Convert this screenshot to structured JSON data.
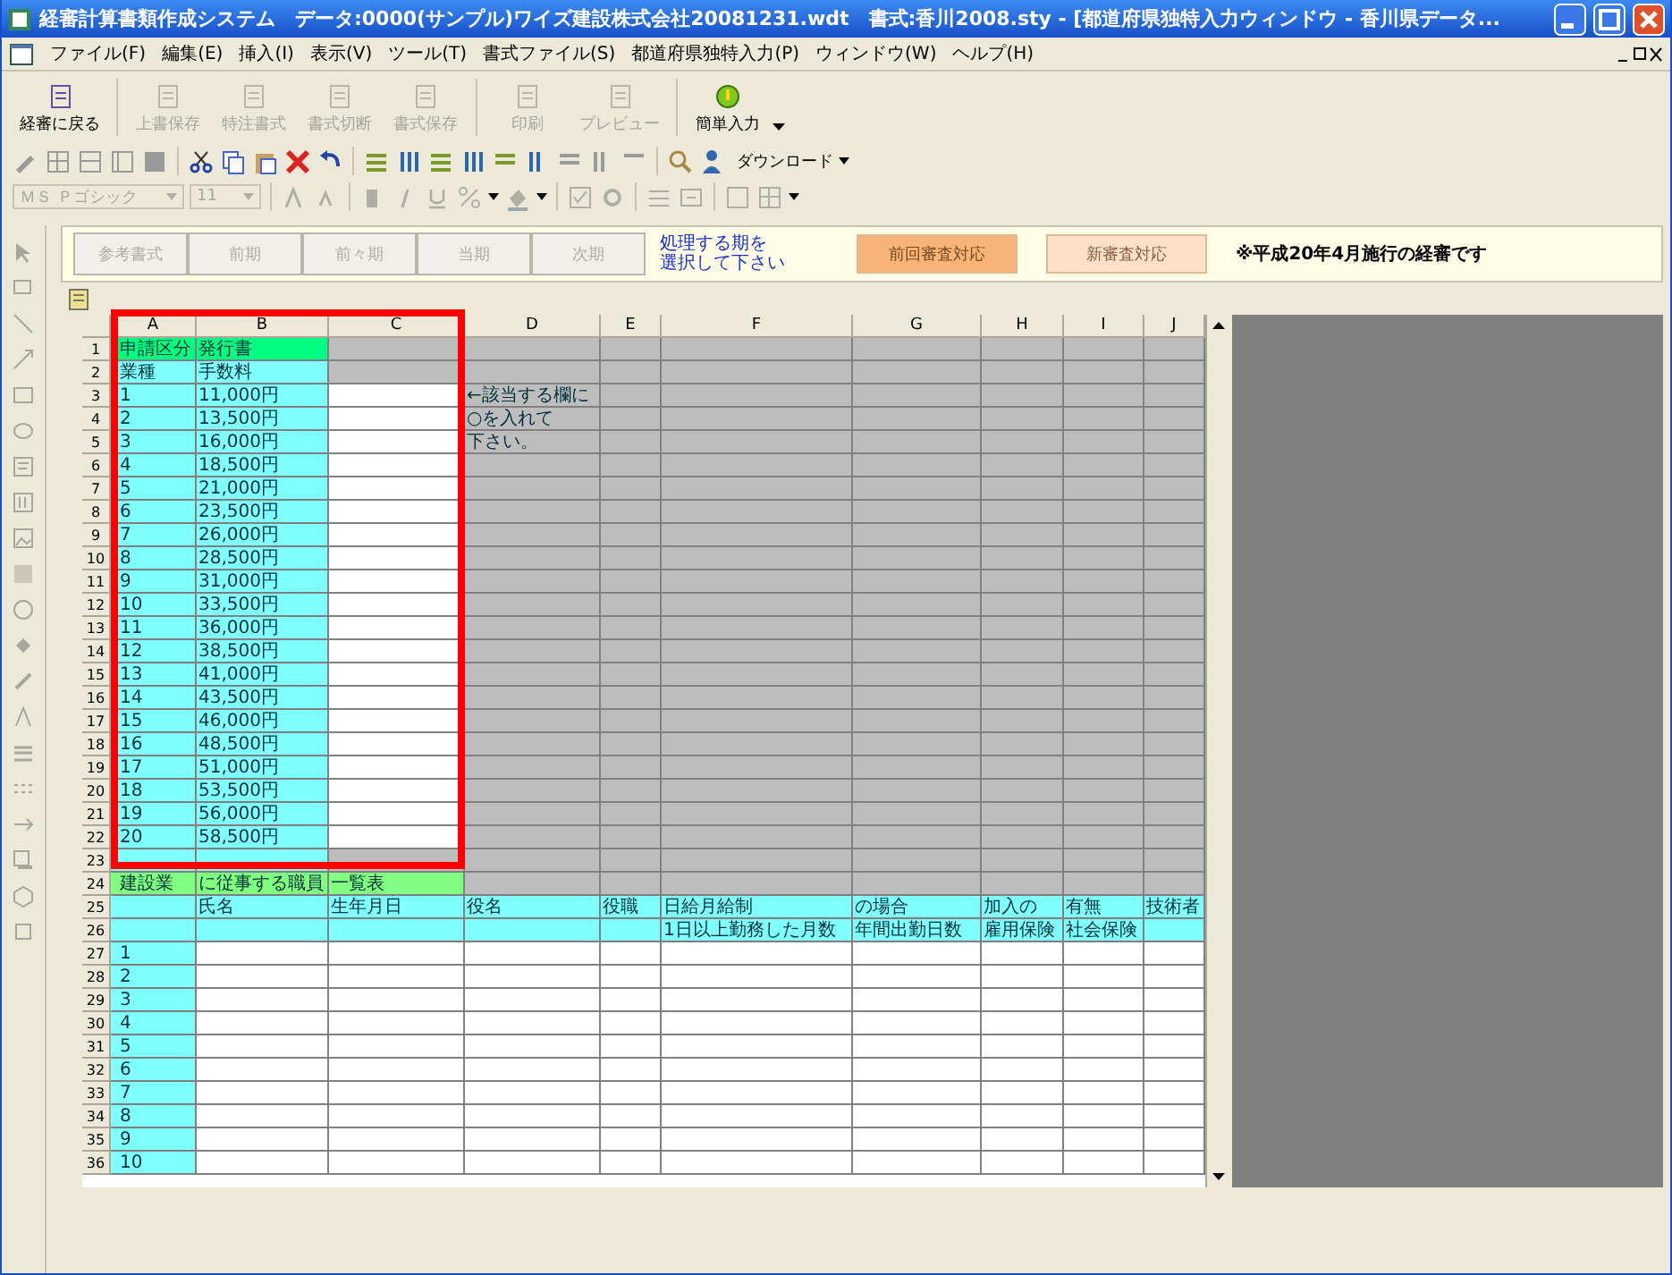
{
  "window": {
    "title": "経審計算書類作成システム　データ:0000(サンプル)ワイズ建設株式会社20081231.wdt　書式:香川2008.sty - [都道府県独特入力ウィンドウ - 香川県データ..."
  },
  "menu": [
    "ファイル(F)",
    "編集(E)",
    "挿入(I)",
    "表示(V)",
    "ツール(T)",
    "書式ファイル(S)",
    "都道府県独特入力(P)",
    "ウィンドウ(W)",
    "ヘルプ(H)"
  ],
  "toolbar": [
    {
      "label": "経審に戻る",
      "disabled": false
    },
    {
      "label": "上書保存",
      "disabled": true
    },
    {
      "label": "特注書式",
      "disabled": true
    },
    {
      "label": "書式切断",
      "disabled": true
    },
    {
      "label": "書式保存",
      "disabled": true
    },
    {
      "label": "印刷",
      "disabled": true
    },
    {
      "label": "プレビュー",
      "disabled": true
    },
    {
      "label": "簡単入力",
      "disabled": false
    }
  ],
  "download_button": "ダウンロード",
  "font_field": {
    "value": "ＭＳ Ｐゴシック",
    "disabled": true
  },
  "size_field": {
    "value": "11",
    "disabled": true
  },
  "period_buttons": [
    {
      "label": "参考書式",
      "disabled": true
    },
    {
      "label": "前期",
      "disabled": true
    },
    {
      "label": "前々期",
      "disabled": true
    },
    {
      "label": "当期",
      "disabled": true
    },
    {
      "label": "次期",
      "disabled": true
    }
  ],
  "period_hint": [
    "処理する期を",
    "選択して下さい"
  ],
  "review_buttons": [
    {
      "label": "前回審査対応",
      "selected": true
    },
    {
      "label": "新審査対応",
      "selected": false
    }
  ],
  "notice": "※平成20年4月施行の経審です",
  "sheet": {
    "columns": [
      "A",
      "B",
      "C",
      "D",
      "E",
      "F",
      "G",
      "H",
      "I",
      "J"
    ],
    "rows": [
      {
        "number": "1",
        "cells": [
          {
            "kind": "heading",
            "text": "申請区分"
          },
          {
            "kind": "heading",
            "text": "発行書"
          },
          {
            "kind": "locked"
          },
          {
            "kind": "locked"
          },
          {
            "kind": "locked"
          },
          {
            "kind": "locked"
          },
          {
            "kind": "locked"
          },
          {
            "kind": "locked"
          },
          {
            "kind": "locked"
          },
          {
            "kind": "locked"
          }
        ]
      },
      {
        "number": "2",
        "cells": [
          {
            "kind": "label",
            "text": "業種"
          },
          {
            "kind": "label",
            "text": "手数料"
          },
          {
            "kind": "locked"
          },
          {
            "kind": "locked"
          },
          {
            "kind": "locked"
          },
          {
            "kind": "locked"
          },
          {
            "kind": "locked"
          },
          {
            "kind": "locked"
          },
          {
            "kind": "locked"
          },
          {
            "kind": "locked"
          }
        ]
      },
      {
        "number": "3",
        "cells": [
          {
            "kind": "label",
            "text": "1"
          },
          {
            "kind": "label",
            "text": "11,000円"
          },
          {
            "kind": "entry"
          },
          {
            "kind": "locked",
            "text": "←該当する欄に"
          },
          {
            "kind": "locked"
          },
          {
            "kind": "locked"
          },
          {
            "kind": "locked"
          },
          {
            "kind": "locked"
          },
          {
            "kind": "locked"
          },
          {
            "kind": "locked"
          }
        ]
      },
      {
        "number": "4",
        "cells": [
          {
            "kind": "label",
            "text": "2"
          },
          {
            "kind": "label",
            "text": "13,500円"
          },
          {
            "kind": "entry"
          },
          {
            "kind": "locked",
            "text": "○を入れて"
          },
          {
            "kind": "locked"
          },
          {
            "kind": "locked"
          },
          {
            "kind": "locked"
          },
          {
            "kind": "locked"
          },
          {
            "kind": "locked"
          },
          {
            "kind": "locked"
          }
        ]
      },
      {
        "number": "5",
        "cells": [
          {
            "kind": "label",
            "text": "3"
          },
          {
            "kind": "label",
            "text": "16,000円"
          },
          {
            "kind": "entry"
          },
          {
            "kind": "locked",
            "text": "下さい。"
          },
          {
            "kind": "locked"
          },
          {
            "kind": "locked"
          },
          {
            "kind": "locked"
          },
          {
            "kind": "locked"
          },
          {
            "kind": "locked"
          },
          {
            "kind": "locked"
          }
        ]
      },
      {
        "number": "6",
        "cells": [
          {
            "kind": "label",
            "text": "4"
          },
          {
            "kind": "label",
            "text": "18,500円"
          },
          {
            "kind": "entry"
          },
          {
            "kind": "locked"
          },
          {
            "kind": "locked"
          },
          {
            "kind": "locked"
          },
          {
            "kind": "locked"
          },
          {
            "kind": "locked"
          },
          {
            "kind": "locked"
          },
          {
            "kind": "locked"
          }
        ]
      },
      {
        "number": "7",
        "cells": [
          {
            "kind": "label",
            "text": "5"
          },
          {
            "kind": "label",
            "text": "21,000円"
          },
          {
            "kind": "entry"
          },
          {
            "kind": "locked"
          },
          {
            "kind": "locked"
          },
          {
            "kind": "locked"
          },
          {
            "kind": "locked"
          },
          {
            "kind": "locked"
          },
          {
            "kind": "locked"
          },
          {
            "kind": "locked"
          }
        ]
      },
      {
        "number": "8",
        "cells": [
          {
            "kind": "label",
            "text": "6"
          },
          {
            "kind": "label",
            "text": "23,500円"
          },
          {
            "kind": "entry"
          },
          {
            "kind": "locked"
          },
          {
            "kind": "locked"
          },
          {
            "kind": "locked"
          },
          {
            "kind": "locked"
          },
          {
            "kind": "locked"
          },
          {
            "kind": "locked"
          },
          {
            "kind": "locked"
          }
        ]
      },
      {
        "number": "9",
        "cells": [
          {
            "kind": "label",
            "text": "7"
          },
          {
            "kind": "label",
            "text": "26,000円"
          },
          {
            "kind": "entry"
          },
          {
            "kind": "locked"
          },
          {
            "kind": "locked"
          },
          {
            "kind": "locked"
          },
          {
            "kind": "locked"
          },
          {
            "kind": "locked"
          },
          {
            "kind": "locked"
          },
          {
            "kind": "locked"
          }
        ]
      },
      {
        "number": "10",
        "cells": [
          {
            "kind": "label",
            "text": "8"
          },
          {
            "kind": "label",
            "text": "28,500円"
          },
          {
            "kind": "entry"
          },
          {
            "kind": "locked"
          },
          {
            "kind": "locked"
          },
          {
            "kind": "locked"
          },
          {
            "kind": "locked"
          },
          {
            "kind": "locked"
          },
          {
            "kind": "locked"
          },
          {
            "kind": "locked"
          }
        ]
      },
      {
        "number": "11",
        "cells": [
          {
            "kind": "label",
            "text": "9"
          },
          {
            "kind": "label",
            "text": "31,000円"
          },
          {
            "kind": "entry"
          },
          {
            "kind": "locked"
          },
          {
            "kind": "locked"
          },
          {
            "kind": "locked"
          },
          {
            "kind": "locked"
          },
          {
            "kind": "locked"
          },
          {
            "kind": "locked"
          },
          {
            "kind": "locked"
          }
        ]
      },
      {
        "number": "12",
        "cells": [
          {
            "kind": "label",
            "text": "10"
          },
          {
            "kind": "label",
            "text": "33,500円"
          },
          {
            "kind": "entry"
          },
          {
            "kind": "locked"
          },
          {
            "kind": "locked"
          },
          {
            "kind": "locked"
          },
          {
            "kind": "locked"
          },
          {
            "kind": "locked"
          },
          {
            "kind": "locked"
          },
          {
            "kind": "locked"
          }
        ]
      },
      {
        "number": "13",
        "cells": [
          {
            "kind": "label",
            "text": "11"
          },
          {
            "kind": "label",
            "text": "36,000円"
          },
          {
            "kind": "entry"
          },
          {
            "kind": "locked"
          },
          {
            "kind": "locked"
          },
          {
            "kind": "locked"
          },
          {
            "kind": "locked"
          },
          {
            "kind": "locked"
          },
          {
            "kind": "locked"
          },
          {
            "kind": "locked"
          }
        ]
      },
      {
        "number": "14",
        "cells": [
          {
            "kind": "label",
            "text": "12"
          },
          {
            "kind": "label",
            "text": "38,500円"
          },
          {
            "kind": "entry"
          },
          {
            "kind": "locked"
          },
          {
            "kind": "locked"
          },
          {
            "kind": "locked"
          },
          {
            "kind": "locked"
          },
          {
            "kind": "locked"
          },
          {
            "kind": "locked"
          },
          {
            "kind": "locked"
          }
        ]
      },
      {
        "number": "15",
        "cells": [
          {
            "kind": "label",
            "text": "13"
          },
          {
            "kind": "label",
            "text": "41,000円"
          },
          {
            "kind": "entry"
          },
          {
            "kind": "locked"
          },
          {
            "kind": "locked"
          },
          {
            "kind": "locked"
          },
          {
            "kind": "locked"
          },
          {
            "kind": "locked"
          },
          {
            "kind": "locked"
          },
          {
            "kind": "locked"
          }
        ]
      },
      {
        "number": "16",
        "cells": [
          {
            "kind": "label",
            "text": "14"
          },
          {
            "kind": "label",
            "text": "43,500円"
          },
          {
            "kind": "entry"
          },
          {
            "kind": "locked"
          },
          {
            "kind": "locked"
          },
          {
            "kind": "locked"
          },
          {
            "kind": "locked"
          },
          {
            "kind": "locked"
          },
          {
            "kind": "locked"
          },
          {
            "kind": "locked"
          }
        ]
      },
      {
        "number": "17",
        "cells": [
          {
            "kind": "label",
            "text": "15"
          },
          {
            "kind": "label",
            "text": "46,000円"
          },
          {
            "kind": "entry"
          },
          {
            "kind": "locked"
          },
          {
            "kind": "locked"
          },
          {
            "kind": "locked"
          },
          {
            "kind": "locked"
          },
          {
            "kind": "locked"
          },
          {
            "kind": "locked"
          },
          {
            "kind": "locked"
          }
        ]
      },
      {
        "number": "18",
        "cells": [
          {
            "kind": "label",
            "text": "16"
          },
          {
            "kind": "label",
            "text": "48,500円"
          },
          {
            "kind": "entry"
          },
          {
            "kind": "locked"
          },
          {
            "kind": "locked"
          },
          {
            "kind": "locked"
          },
          {
            "kind": "locked"
          },
          {
            "kind": "locked"
          },
          {
            "kind": "locked"
          },
          {
            "kind": "locked"
          }
        ]
      },
      {
        "number": "19",
        "cells": [
          {
            "kind": "label",
            "text": "17"
          },
          {
            "kind": "label",
            "text": "51,000円"
          },
          {
            "kind": "entry"
          },
          {
            "kind": "locked"
          },
          {
            "kind": "locked"
          },
          {
            "kind": "locked"
          },
          {
            "kind": "locked"
          },
          {
            "kind": "locked"
          },
          {
            "kind": "locked"
          },
          {
            "kind": "locked"
          }
        ]
      },
      {
        "number": "20",
        "cells": [
          {
            "kind": "label",
            "text": "18"
          },
          {
            "kind": "label",
            "text": "53,500円"
          },
          {
            "kind": "entry"
          },
          {
            "kind": "locked"
          },
          {
            "kind": "locked"
          },
          {
            "kind": "locked"
          },
          {
            "kind": "locked"
          },
          {
            "kind": "locked"
          },
          {
            "kind": "locked"
          },
          {
            "kind": "locked"
          }
        ]
      },
      {
        "number": "21",
        "cells": [
          {
            "kind": "label",
            "text": "19"
          },
          {
            "kind": "label",
            "text": "56,000円"
          },
          {
            "kind": "entry"
          },
          {
            "kind": "locked"
          },
          {
            "kind": "locked"
          },
          {
            "kind": "locked"
          },
          {
            "kind": "locked"
          },
          {
            "kind": "locked"
          },
          {
            "kind": "locked"
          },
          {
            "kind": "locked"
          }
        ]
      },
      {
        "number": "22",
        "cells": [
          {
            "kind": "label",
            "text": "20"
          },
          {
            "kind": "label",
            "text": "58,500円"
          },
          {
            "kind": "entry"
          },
          {
            "kind": "locked"
          },
          {
            "kind": "locked"
          },
          {
            "kind": "locked"
          },
          {
            "kind": "locked"
          },
          {
            "kind": "locked"
          },
          {
            "kind": "locked"
          },
          {
            "kind": "locked"
          }
        ]
      },
      {
        "number": "23",
        "cells": [
          {
            "kind": "label"
          },
          {
            "kind": "label"
          },
          {
            "kind": "locked"
          },
          {
            "kind": "locked"
          },
          {
            "kind": "locked"
          },
          {
            "kind": "locked"
          },
          {
            "kind": "locked"
          },
          {
            "kind": "locked"
          },
          {
            "kind": "locked"
          },
          {
            "kind": "locked"
          }
        ]
      },
      {
        "number": "24",
        "cells": [
          {
            "kind": "caption",
            "text": "建設業"
          },
          {
            "kind": "caption",
            "text": "に従事する職員"
          },
          {
            "kind": "caption",
            "text": "一覧表"
          },
          {
            "kind": "locked"
          },
          {
            "kind": "locked"
          },
          {
            "kind": "locked"
          },
          {
            "kind": "locked"
          },
          {
            "kind": "locked"
          },
          {
            "kind": "locked"
          },
          {
            "kind": "locked"
          }
        ]
      },
      {
        "number": "25",
        "cells": [
          {
            "kind": "label"
          },
          {
            "kind": "label",
            "text": "氏名"
          },
          {
            "kind": "label",
            "text": "生年月日"
          },
          {
            "kind": "label",
            "text": "役名"
          },
          {
            "kind": "label",
            "text": "役職"
          },
          {
            "kind": "label",
            "text": "日給月給制"
          },
          {
            "kind": "label",
            "text": "の場合"
          },
          {
            "kind": "label",
            "text": "加入の"
          },
          {
            "kind": "label",
            "text": "有無"
          },
          {
            "kind": "label",
            "text": "技術者"
          }
        ]
      },
      {
        "number": "26",
        "cells": [
          {
            "kind": "label"
          },
          {
            "kind": "label"
          },
          {
            "kind": "label"
          },
          {
            "kind": "label"
          },
          {
            "kind": "label"
          },
          {
            "kind": "label",
            "text": "1日以上勤務した月数"
          },
          {
            "kind": "label",
            "text": "年間出勤日数"
          },
          {
            "kind": "label",
            "text": "雇用保険"
          },
          {
            "kind": "label",
            "text": "社会保険"
          },
          {
            "kind": "label"
          }
        ]
      },
      {
        "number": "27",
        "cells": [
          {
            "kind": "label",
            "text": "1"
          },
          {
            "kind": "entry"
          },
          {
            "kind": "entry"
          },
          {
            "kind": "entry"
          },
          {
            "kind": "entry"
          },
          {
            "kind": "entry"
          },
          {
            "kind": "entry"
          },
          {
            "kind": "entry"
          },
          {
            "kind": "entry"
          },
          {
            "kind": "entry"
          }
        ]
      },
      {
        "number": "28",
        "cells": [
          {
            "kind": "label",
            "text": "2"
          },
          {
            "kind": "entry"
          },
          {
            "kind": "entry"
          },
          {
            "kind": "entry"
          },
          {
            "kind": "entry"
          },
          {
            "kind": "entry"
          },
          {
            "kind": "entry"
          },
          {
            "kind": "entry"
          },
          {
            "kind": "entry"
          },
          {
            "kind": "entry"
          }
        ]
      },
      {
        "number": "29",
        "cells": [
          {
            "kind": "label",
            "text": "3"
          },
          {
            "kind": "entry"
          },
          {
            "kind": "entry"
          },
          {
            "kind": "entry"
          },
          {
            "kind": "entry"
          },
          {
            "kind": "entry"
          },
          {
            "kind": "entry"
          },
          {
            "kind": "entry"
          },
          {
            "kind": "entry"
          },
          {
            "kind": "entry"
          }
        ]
      },
      {
        "number": "30",
        "cells": [
          {
            "kind": "label",
            "text": "4"
          },
          {
            "kind": "entry"
          },
          {
            "kind": "entry"
          },
          {
            "kind": "entry"
          },
          {
            "kind": "entry"
          },
          {
            "kind": "entry"
          },
          {
            "kind": "entry"
          },
          {
            "kind": "entry"
          },
          {
            "kind": "entry"
          },
          {
            "kind": "entry"
          }
        ]
      },
      {
        "number": "31",
        "cells": [
          {
            "kind": "label",
            "text": "5"
          },
          {
            "kind": "entry"
          },
          {
            "kind": "entry"
          },
          {
            "kind": "entry"
          },
          {
            "kind": "entry"
          },
          {
            "kind": "entry"
          },
          {
            "kind": "entry"
          },
          {
            "kind": "entry"
          },
          {
            "kind": "entry"
          },
          {
            "kind": "entry"
          }
        ]
      },
      {
        "number": "32",
        "cells": [
          {
            "kind": "label",
            "text": "6"
          },
          {
            "kind": "entry"
          },
          {
            "kind": "entry"
          },
          {
            "kind": "entry"
          },
          {
            "kind": "entry"
          },
          {
            "kind": "entry"
          },
          {
            "kind": "entry"
          },
          {
            "kind": "entry"
          },
          {
            "kind": "entry"
          },
          {
            "kind": "entry"
          }
        ]
      },
      {
        "number": "33",
        "cells": [
          {
            "kind": "label",
            "text": "7"
          },
          {
            "kind": "entry"
          },
          {
            "kind": "entry"
          },
          {
            "kind": "entry"
          },
          {
            "kind": "entry"
          },
          {
            "kind": "entry"
          },
          {
            "kind": "entry"
          },
          {
            "kind": "entry"
          },
          {
            "kind": "entry"
          },
          {
            "kind": "entry"
          }
        ]
      },
      {
        "number": "34",
        "cells": [
          {
            "kind": "label",
            "text": "8"
          },
          {
            "kind": "entry"
          },
          {
            "kind": "entry"
          },
          {
            "kind": "entry"
          },
          {
            "kind": "entry"
          },
          {
            "kind": "entry"
          },
          {
            "kind": "entry"
          },
          {
            "kind": "entry"
          },
          {
            "kind": "entry"
          },
          {
            "kind": "entry"
          }
        ]
      },
      {
        "number": "35",
        "cells": [
          {
            "kind": "label",
            "text": "9"
          },
          {
            "kind": "entry"
          },
          {
            "kind": "entry"
          },
          {
            "kind": "entry"
          },
          {
            "kind": "entry"
          },
          {
            "kind": "entry"
          },
          {
            "kind": "entry"
          },
          {
            "kind": "entry"
          },
          {
            "kind": "entry"
          },
          {
            "kind": "entry"
          }
        ]
      },
      {
        "number": "36",
        "cells": [
          {
            "kind": "label",
            "text": "10"
          },
          {
            "kind": "entry"
          },
          {
            "kind": "entry"
          },
          {
            "kind": "entry"
          },
          {
            "kind": "entry"
          },
          {
            "kind": "entry"
          },
          {
            "kind": "entry"
          },
          {
            "kind": "entry"
          },
          {
            "kind": "entry"
          },
          {
            "kind": "entry"
          }
        ]
      }
    ]
  }
}
